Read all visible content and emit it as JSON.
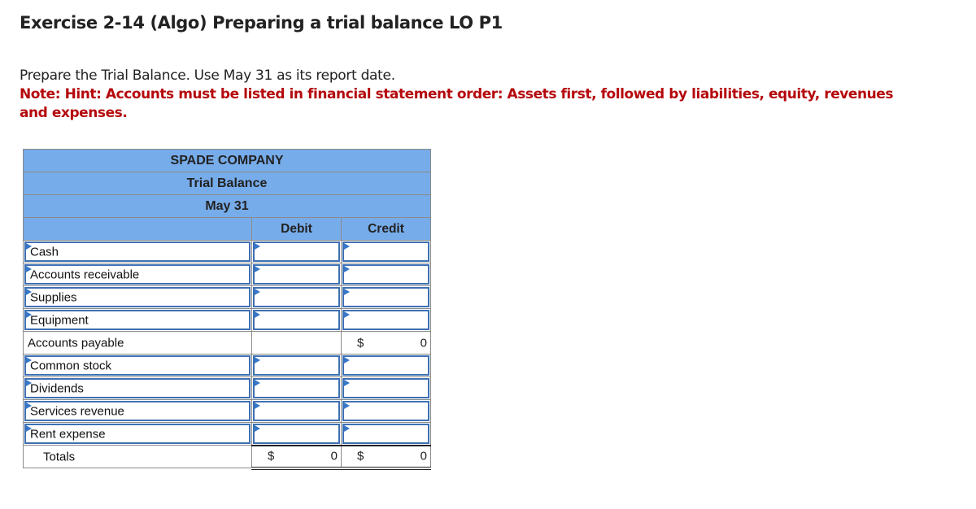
{
  "header": {
    "title": "Exercise 2-14 (Algo) Preparing a trial balance LO P1"
  },
  "instructions": {
    "text": "Prepare the Trial Balance. Use May 31 as its report date.",
    "note": "Note: Hint: Accounts must be listed in financial statement order: Assets first, followed by liabilities, equity, revenues and expenses."
  },
  "colors": {
    "header_fill": "#77acea",
    "note_red": "#b5090d",
    "input_border": "#3e70b3"
  },
  "trial_balance": {
    "company": "SPADE COMPANY",
    "statement": "Trial Balance",
    "date": "May 31",
    "columns": {
      "account": "",
      "debit": "Debit",
      "credit": "Credit"
    },
    "rows": [
      {
        "account": "Cash",
        "debit": "",
        "credit": "",
        "editable": true
      },
      {
        "account": "Accounts receivable",
        "debit": "",
        "credit": "",
        "editable": true
      },
      {
        "account": "Supplies",
        "debit": "",
        "credit": "",
        "editable": true
      },
      {
        "account": "Equipment",
        "debit": "",
        "credit": "",
        "editable": true
      },
      {
        "account": "Accounts payable",
        "debit": "",
        "credit_symbol": "$",
        "credit": "0",
        "editable": false
      },
      {
        "account": "Common stock",
        "debit": "",
        "credit": "",
        "editable": true
      },
      {
        "account": "Dividends",
        "debit": "",
        "credit": "",
        "editable": true
      },
      {
        "account": "Services revenue",
        "debit": "",
        "credit": "",
        "editable": true
      },
      {
        "account": "Rent expense",
        "debit": "",
        "credit": "",
        "editable": true
      }
    ],
    "totals": {
      "label": "Totals",
      "debit_symbol": "$",
      "debit": "0",
      "credit_symbol": "$",
      "credit": "0"
    }
  }
}
